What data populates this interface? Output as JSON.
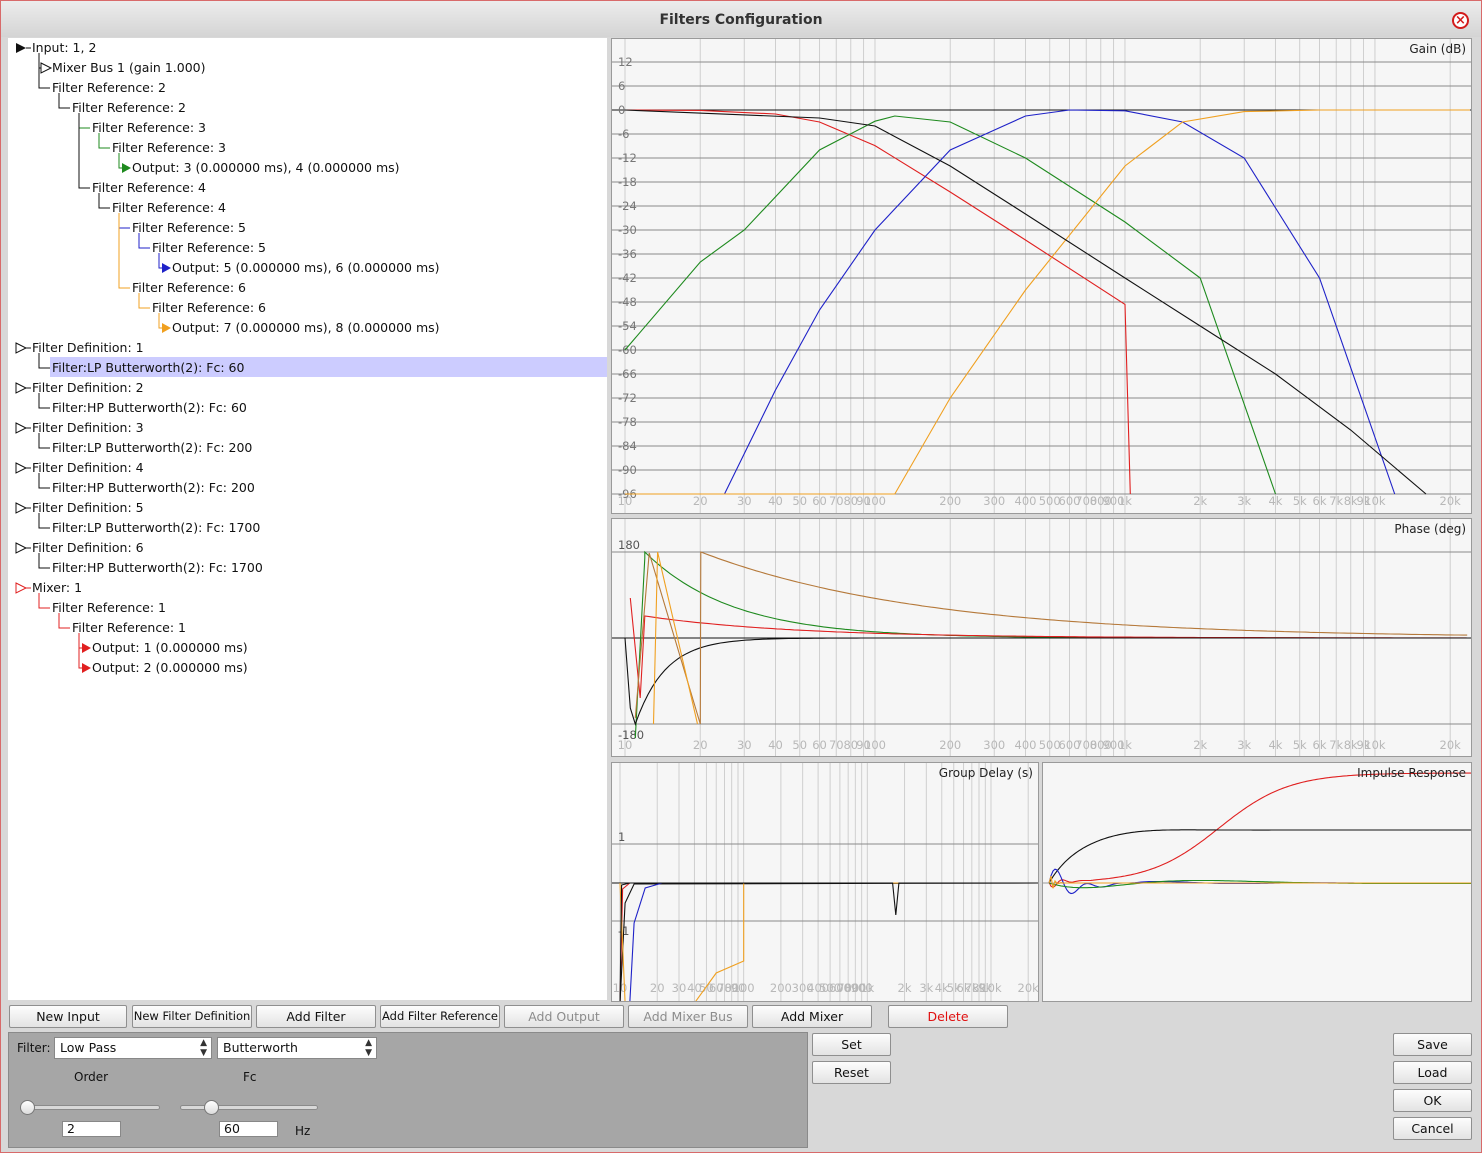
{
  "window": {
    "title": "Filters Configuration"
  },
  "colors": {
    "red": "#e02020",
    "green": "#1e8a1e",
    "blue": "#1f22c8",
    "orange": "#f0a020",
    "black": "#111111",
    "selection": "#ccccff"
  },
  "tree": [
    {
      "text": "Input: 1, 2",
      "depth": 0,
      "marker": "filled-triangle",
      "color": "#111111"
    },
    {
      "text": "Mixer Bus 1 (gain 1.000)",
      "depth": 1,
      "marker": "hollow-triangle",
      "color": "#111111"
    },
    {
      "text": "Filter Reference: 2",
      "depth": 1,
      "color": "#111111"
    },
    {
      "text": "Filter Reference: 2",
      "depth": 2,
      "color": "#111111"
    },
    {
      "text": "Filter Reference: 3",
      "depth": 3,
      "color": "#1e8a1e"
    },
    {
      "text": "Filter Reference: 3",
      "depth": 4,
      "color": "#1e8a1e"
    },
    {
      "text": "Output: 3 (0.000000 ms), 4 (0.000000 ms)",
      "depth": 5,
      "marker": "output-arrow",
      "color": "#1e8a1e"
    },
    {
      "text": "Filter Reference: 4",
      "depth": 3,
      "color": "#111111"
    },
    {
      "text": "Filter Reference: 4",
      "depth": 4,
      "color": "#111111"
    },
    {
      "text": "Filter Reference: 5",
      "depth": 5,
      "color": "#1f22c8"
    },
    {
      "text": "Filter Reference: 5",
      "depth": 6,
      "color": "#1f22c8"
    },
    {
      "text": "Output: 5 (0.000000 ms), 6 (0.000000 ms)",
      "depth": 7,
      "marker": "output-arrow",
      "color": "#1f22c8"
    },
    {
      "text": "Filter Reference: 6",
      "depth": 5,
      "color": "#f0a020"
    },
    {
      "text": "Filter Reference: 6",
      "depth": 6,
      "color": "#f0a020"
    },
    {
      "text": "Output: 7 (0.000000 ms), 8 (0.000000 ms)",
      "depth": 7,
      "marker": "output-arrow",
      "color": "#f0a020"
    },
    {
      "text": "Filter Definition: 1",
      "depth": 0,
      "marker": "hollow-triangle",
      "color": "#111111"
    },
    {
      "text": "Filter:LP Butterworth(2): Fc: 60",
      "depth": 1,
      "color": "#111111",
      "selected": true
    },
    {
      "text": "Filter Definition: 2",
      "depth": 0,
      "marker": "hollow-triangle",
      "color": "#111111"
    },
    {
      "text": "Filter:HP Butterworth(2): Fc: 60",
      "depth": 1,
      "color": "#111111"
    },
    {
      "text": "Filter Definition: 3",
      "depth": 0,
      "marker": "hollow-triangle",
      "color": "#111111"
    },
    {
      "text": "Filter:LP Butterworth(2): Fc: 200",
      "depth": 1,
      "color": "#111111"
    },
    {
      "text": "Filter Definition: 4",
      "depth": 0,
      "marker": "hollow-triangle",
      "color": "#111111"
    },
    {
      "text": "Filter:HP Butterworth(2): Fc: 200",
      "depth": 1,
      "color": "#111111"
    },
    {
      "text": "Filter Definition: 5",
      "depth": 0,
      "marker": "hollow-triangle",
      "color": "#111111"
    },
    {
      "text": "Filter:LP Butterworth(2): Fc: 1700",
      "depth": 1,
      "color": "#111111"
    },
    {
      "text": "Filter Definition: 6",
      "depth": 0,
      "marker": "hollow-triangle",
      "color": "#111111"
    },
    {
      "text": "Filter:HP Butterworth(2): Fc: 1700",
      "depth": 1,
      "color": "#111111"
    },
    {
      "text": "Mixer: 1",
      "depth": 0,
      "marker": "hollow-triangle-red",
      "color": "#e02020"
    },
    {
      "text": "Filter Reference: 1",
      "depth": 1,
      "color": "#e02020"
    },
    {
      "text": "Filter Reference: 1",
      "depth": 2,
      "color": "#e02020"
    },
    {
      "text": "Output: 1 (0.000000 ms)",
      "depth": 3,
      "marker": "output-arrow",
      "color": "#e02020"
    },
    {
      "text": "Output: 2 (0.000000 ms)",
      "depth": 3,
      "marker": "output-arrow",
      "color": "#e02020"
    }
  ],
  "plots": {
    "gain": {
      "title": "Gain (dB)",
      "yticks": [
        "12",
        "6",
        "0",
        "-6",
        "-12",
        "-18",
        "-24",
        "-30",
        "-36",
        "-42",
        "-48",
        "-54",
        "-60",
        "-66",
        "-72",
        "-78",
        "-84",
        "-90",
        "-96"
      ],
      "xticks": [
        "10",
        "20",
        "30",
        "40",
        "50",
        "60",
        "70",
        "80",
        "90",
        "100",
        "200",
        "300",
        "400",
        "500",
        "600",
        "700",
        "800",
        "900",
        "1k",
        "2k",
        "3k",
        "4k",
        "5k",
        "6k",
        "7k",
        "8k",
        "9k",
        "10k",
        "20k"
      ]
    },
    "phase": {
      "title": "Phase (deg)",
      "yticks": [
        "180",
        "-180"
      ],
      "xticks": [
        "10",
        "20",
        "30",
        "40",
        "50",
        "60",
        "70",
        "80",
        "90",
        "100",
        "200",
        "300",
        "400",
        "500",
        "600",
        "700",
        "800",
        "900",
        "1k",
        "2k",
        "3k",
        "4k",
        "5k",
        "6k",
        "7k",
        "8k",
        "9k",
        "10k",
        "20k"
      ]
    },
    "group_delay": {
      "title": "Group Delay (s)",
      "yticks": [
        "1",
        "-1"
      ],
      "xticks": [
        "10",
        "20",
        "30",
        "40",
        "50",
        "60",
        "70",
        "80",
        "90",
        "100",
        "200",
        "300",
        "400",
        "500",
        "600",
        "700",
        "800",
        "900",
        "1k",
        "2k",
        "3k",
        "4k",
        "5k",
        "6k",
        "7k",
        "8k",
        "9k",
        "10k",
        "20k"
      ]
    },
    "impulse": {
      "title": "Impulse Response"
    }
  },
  "chart_data": [
    {
      "type": "line",
      "title": "Gain (dB)",
      "xscale": "log",
      "xlim": [
        10,
        24000
      ],
      "ylim": [
        -96,
        12
      ],
      "series": [
        {
          "color": "#e02020",
          "x": [
            10,
            20,
            40,
            60,
            100,
            200,
            400,
            1000,
            1050
          ],
          "y": [
            0,
            -0.1,
            -1,
            -3,
            -8.9,
            -20.5,
            -32.5,
            -48.6,
            -96
          ]
        },
        {
          "color": "#1e8a1e",
          "x": [
            10,
            20,
            30,
            60,
            100,
            120,
            200,
            400,
            1000,
            2000,
            4000
          ],
          "y": [
            -60,
            -38,
            -30,
            -10,
            -2.8,
            -1.5,
            -3,
            -12,
            -28,
            -42,
            -96
          ]
        },
        {
          "color": "#1f22c8",
          "x": [
            25,
            40,
            60,
            100,
            200,
            400,
            600,
            1000,
            1700,
            3000,
            6000,
            12000
          ],
          "y": [
            -96,
            -70,
            -50,
            -30,
            -10,
            -1.5,
            0,
            -0.2,
            -3,
            -12,
            -42,
            -96
          ]
        },
        {
          "color": "#f0a020",
          "x": [
            10,
            120,
            200,
            400,
            1000,
            1700,
            3000,
            6000,
            24000
          ],
          "y": [
            -96,
            -96,
            -72,
            -45,
            -14,
            -3,
            -0.4,
            0,
            0
          ]
        },
        {
          "color": "#111111",
          "x": [
            10,
            60,
            100,
            200,
            400,
            1000,
            2000,
            4000,
            8000,
            16000
          ],
          "y": [
            0,
            -2,
            -4,
            -14,
            -26,
            -42,
            -54,
            -66,
            -80,
            -96
          ]
        }
      ]
    },
    {
      "type": "line",
      "title": "Phase (deg)",
      "xscale": "log",
      "xlim": [
        10,
        24000
      ],
      "ylim": [
        -180,
        180
      ]
    },
    {
      "type": "line",
      "title": "Group Delay (s)",
      "xscale": "log",
      "xlim": [
        10,
        24000
      ],
      "ylim": [
        -2,
        2
      ]
    },
    {
      "type": "line",
      "title": "Impulse Response"
    }
  ],
  "toolbar": {
    "new_input": "New Input",
    "new_filter_definition": "New Filter Definition",
    "add_filter": "Add Filter",
    "add_filter_reference": "Add Filter Reference",
    "add_output": "Add Output",
    "add_mixer_bus": "Add Mixer Bus",
    "add_mixer": "Add Mixer",
    "delete": "Delete"
  },
  "editor": {
    "filter_label": "Filter:",
    "type_value": "Low Pass",
    "design_value": "Butterworth",
    "order_label": "Order",
    "order_value": "2",
    "order_fraction": 0.0,
    "fc_label": "Fc",
    "fc_value": "60",
    "fc_fraction": 0.2,
    "fc_unit": "Hz",
    "set": "Set",
    "reset": "Reset"
  },
  "side_buttons": {
    "save": "Save",
    "load": "Load",
    "ok": "OK",
    "cancel": "Cancel"
  }
}
